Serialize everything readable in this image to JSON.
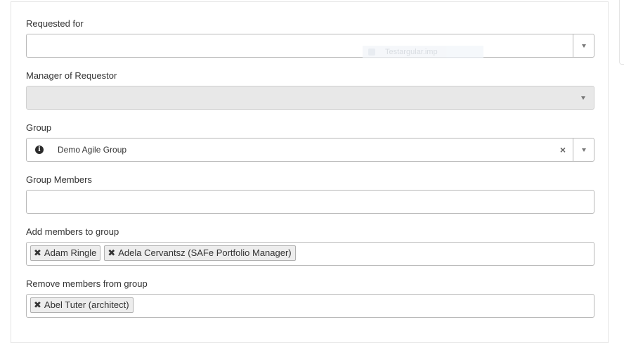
{
  "requested_for": {
    "label": "Requested for",
    "value": "",
    "ghost_text": "Testargular.imp"
  },
  "manager": {
    "label": "Manager of Requestor",
    "value": ""
  },
  "group": {
    "label": "Group",
    "value": "Demo Agile Group",
    "info_glyph": "i",
    "clear_glyph": "×"
  },
  "group_members": {
    "label": "Group Members",
    "value": ""
  },
  "add_members": {
    "label": "Add members to group",
    "tags": [
      {
        "text": "Adam Ringle",
        "remove_glyph": "✖"
      },
      {
        "text": "Adela Cervantsz (SAFe Portfolio Manager)",
        "remove_glyph": "✖"
      }
    ]
  },
  "remove_members": {
    "label": "Remove members from group",
    "tags": [
      {
        "text": "Abel Tuter (architect)",
        "remove_glyph": "✖"
      }
    ]
  },
  "colors": {
    "border": "#b8b8b8",
    "disabled_bg": "#e8e8e8",
    "tag_bg": "#ededed"
  },
  "icons": {
    "info": "info-circle-icon",
    "dropdown": "chevron-down-icon",
    "clear": "close-icon",
    "tag_remove": "close-icon"
  }
}
